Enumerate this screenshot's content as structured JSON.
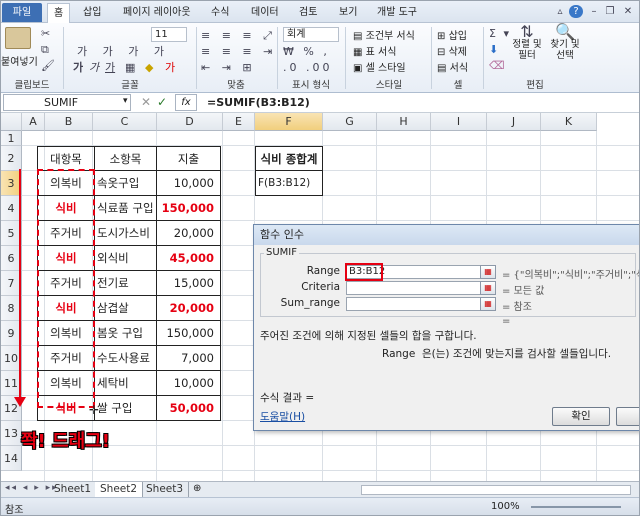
{
  "tabs": [
    "파일",
    "홈",
    "삽입",
    "페이지 레이아웃",
    "수식",
    "데이터",
    "검토",
    "보기",
    "개발 도구"
  ],
  "ribbon": {
    "paste": "붙여넣기",
    "clipboard": "클립보드",
    "font_group": "글꼴",
    "font_size": "11",
    "align_group": "맞춤",
    "number_format": "회계",
    "number_group": "표시 형식",
    "cond_format": "조건부 서식",
    "table_format": "표 서식",
    "cell_style": "셀 스타일",
    "style_group": "스타일",
    "insert": "삽입",
    "delete": "삭제",
    "format": "서식",
    "cells_group": "셀",
    "sort_filter": "정렬 및 필터",
    "find_select": "찾기 및 선택",
    "edit_group": "편집"
  },
  "formula_bar": {
    "name_box": "SUMIF",
    "formula": "=SUMIF(B3:B12)"
  },
  "columns": [
    "A",
    "B",
    "C",
    "D",
    "E",
    "F",
    "G",
    "H",
    "I",
    "J",
    "K"
  ],
  "rows": [
    "1",
    "2",
    "3",
    "4",
    "5",
    "6",
    "7",
    "8",
    "9",
    "10",
    "11",
    "12",
    "13",
    "14"
  ],
  "table": {
    "headers": [
      "대항목",
      "소항목",
      "지출"
    ],
    "rows": [
      [
        "의복비",
        "속옷구입",
        "10,000"
      ],
      [
        "식비",
        "식료품 구입",
        "150,000"
      ],
      [
        "주거비",
        "도시가스비",
        "20,000"
      ],
      [
        "식비",
        "외식비",
        "45,000"
      ],
      [
        "주거비",
        "전기료",
        "15,000"
      ],
      [
        "식비",
        "삼겹살",
        "20,000"
      ],
      [
        "의복비",
        "봄옷 구입",
        "150,000"
      ],
      [
        "주거비",
        "수도사용료",
        "7,000"
      ],
      [
        "의복비",
        "세탁비",
        "10,000"
      ],
      [
        "식비",
        "쌀 구입",
        "50,000"
      ]
    ]
  },
  "f_header": "식비 종합계",
  "f_cell": "F(B3:B12)",
  "annotation": "쫙! 드래그!",
  "dialog": {
    "title": "함수 인수",
    "group": "SUMIF",
    "range_label": "Range",
    "range_value": "B3:B12",
    "range_result": "= {\"의복비\";\"식비\";\"주거비\";\"식",
    "criteria_label": "Criteria",
    "criteria_result": "= 모든 값",
    "sumrange_label": "Sum_range",
    "sumrange_result": "= 참조",
    "eq": "=",
    "description": "주어진 조건에 의해 지정된 셀들의 합을 구합니다.",
    "arg_desc_name": "Range",
    "arg_desc": "은(는) 조건에 맞는지를 검사할 셀들입니다.",
    "result_label": "수식 결과 =",
    "help": "도움말(H)",
    "ok": "확인"
  },
  "sheets": [
    "Sheet1",
    "Sheet2",
    "Sheet3"
  ],
  "status": {
    "mode": "참조",
    "zoom": "100%"
  }
}
